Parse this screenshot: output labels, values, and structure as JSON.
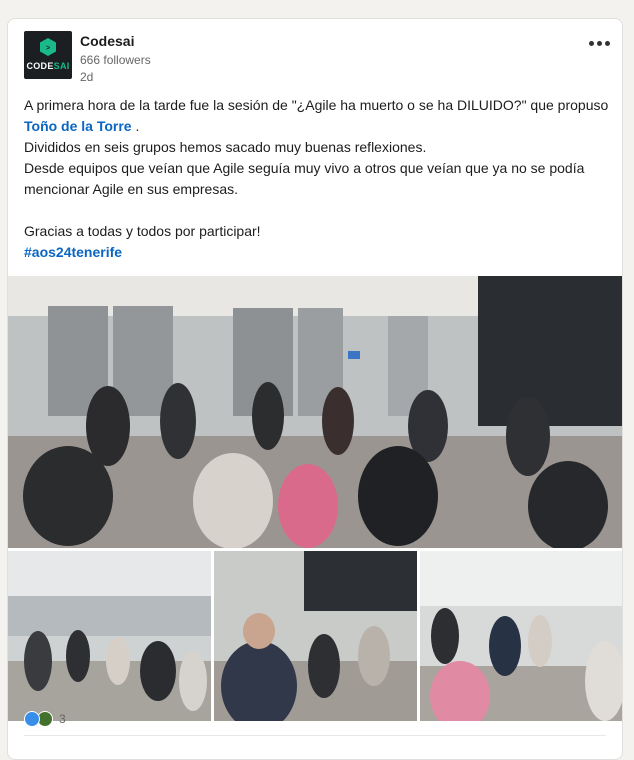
{
  "post": {
    "author": "Codesai",
    "followers": "666 followers",
    "time": "2d",
    "logo": {
      "text_a": "CODE",
      "text_b": "SAI",
      "accent": "#19b98a"
    },
    "text": {
      "line1": "A primera hora de la tarde fue la sesión de \"¿Agile ha muerto o se ha DILUIDO?\" que propuso",
      "mention": "Toño de la Torre",
      "mention_suffix": " .",
      "line2": "Divididos en seis grupos hemos sacado muy buenas reflexiones.",
      "line3": "Desde equipos que veían que Agile seguía muy vivo a otros que veían que ya no se podía mencionar Agile en sus empresas.",
      "line4": "Gracias a todas y todos por participar!",
      "hashtag": "#aos24tenerife"
    },
    "reactions": {
      "count": "3",
      "icons": [
        "like-icon",
        "celebrate-icon"
      ]
    }
  },
  "colors": {
    "link": "#0a66c2",
    "like": "#378fe9",
    "celebrate": "#44712e"
  }
}
